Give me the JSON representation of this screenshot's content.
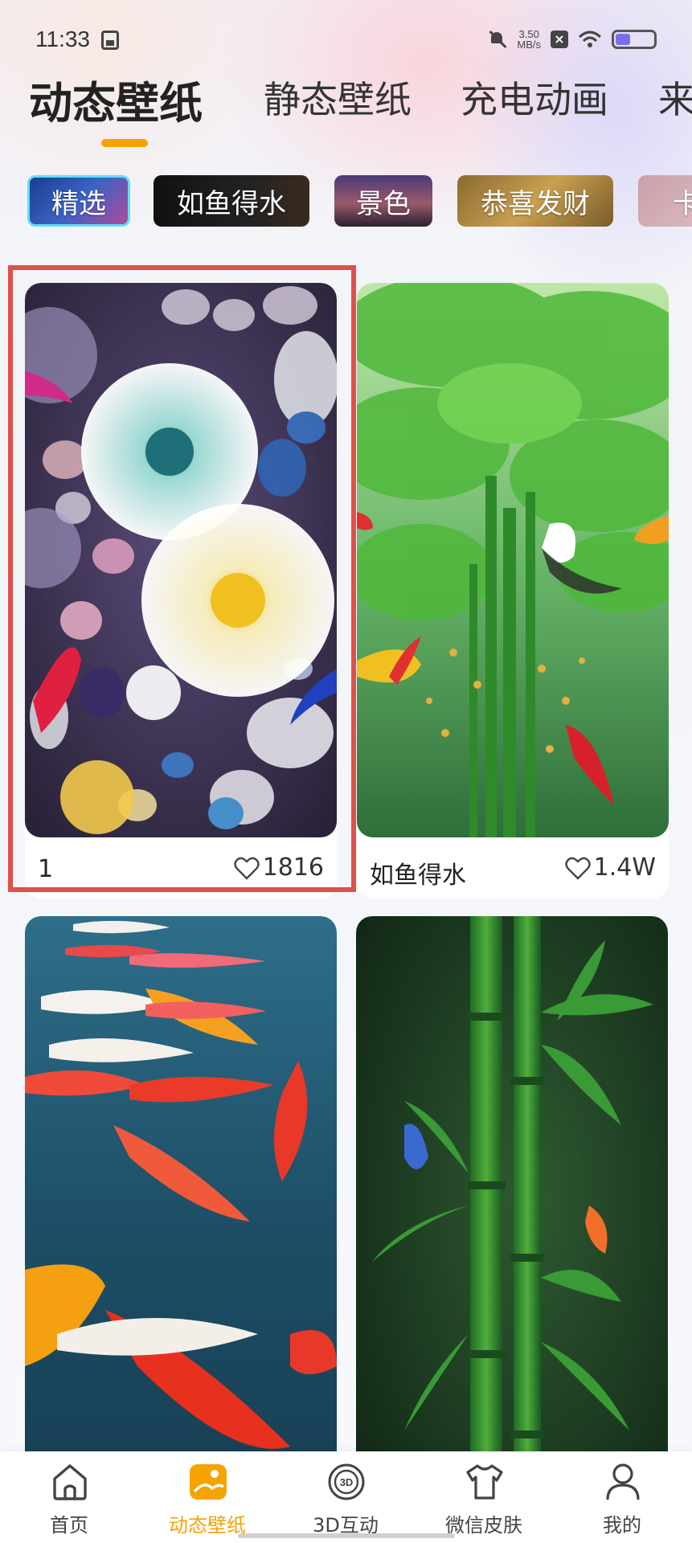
{
  "status_bar": {
    "time": "11:33",
    "speed_value": "3.50",
    "speed_unit": "MB/s"
  },
  "top_tabs": [
    {
      "label": "动态壁纸",
      "active": true
    },
    {
      "label": "静态壁纸",
      "active": false
    },
    {
      "label": "充电动画",
      "active": false
    },
    {
      "label": "来",
      "active": false
    }
  ],
  "categories": [
    {
      "label": "精选",
      "selected": true
    },
    {
      "label": "如鱼得水",
      "selected": false
    },
    {
      "label": "景色",
      "selected": false
    },
    {
      "label": "恭喜发财",
      "selected": false
    },
    {
      "label": "卡",
      "selected": false
    }
  ],
  "wallpapers": [
    {
      "title": "1",
      "likes": "1816"
    },
    {
      "title": "如鱼得水",
      "likes": "1.4W"
    },
    {
      "title": "",
      "likes": ""
    },
    {
      "title": "",
      "likes": ""
    }
  ],
  "bottom_nav": [
    {
      "label": "首页",
      "icon": "home-icon",
      "active": false
    },
    {
      "label": "动态壁纸",
      "icon": "dynamic-wallpaper-icon",
      "active": true
    },
    {
      "label": "3D互动",
      "icon": "3d-icon",
      "active": false
    },
    {
      "label": "微信皮肤",
      "icon": "tshirt-icon",
      "active": false
    },
    {
      "label": "我的",
      "icon": "profile-icon",
      "active": false
    }
  ],
  "colors": {
    "accent": "#f5a300",
    "highlight_border": "#e0504a",
    "selected_chip_border": "#5ee0f4"
  }
}
